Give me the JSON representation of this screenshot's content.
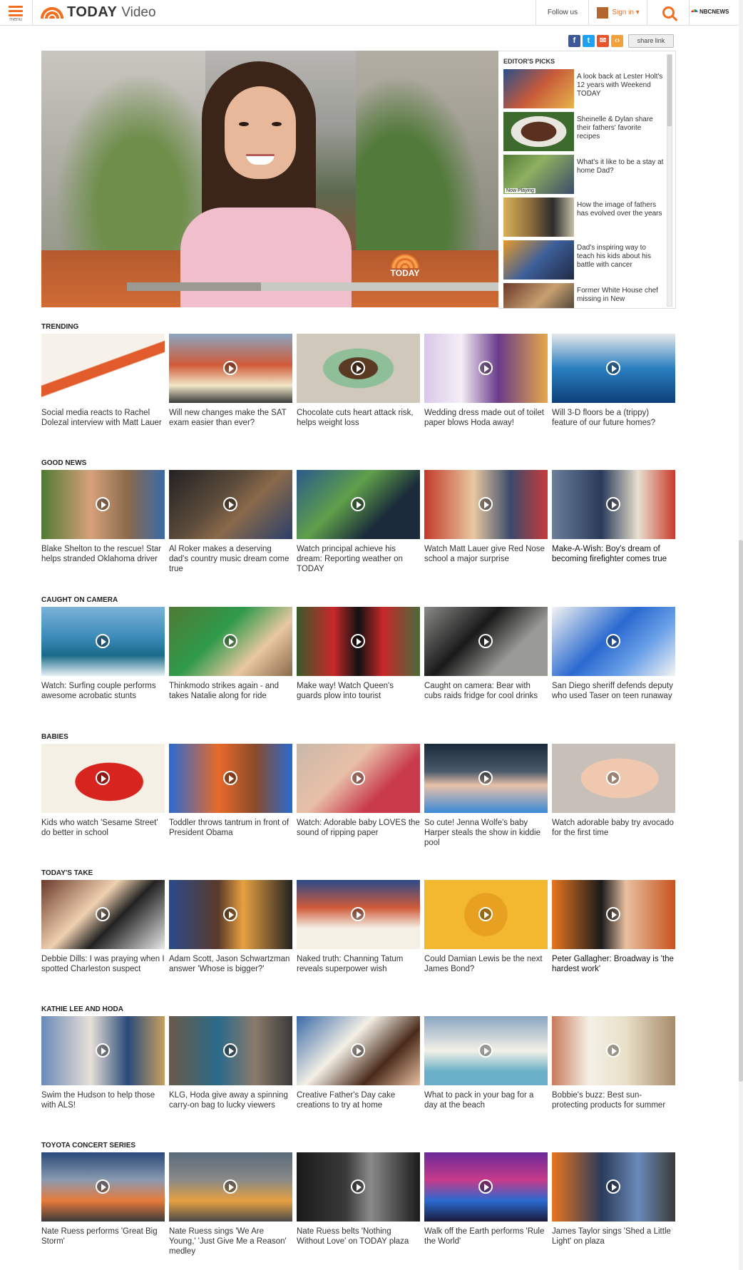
{
  "header": {
    "menu_label": "menu",
    "brand": "TODAY",
    "brand_sub": "Video",
    "follow": "Follow us",
    "signin": "Sign in ▾",
    "network": "NBCNEWS"
  },
  "share": {
    "icons": [
      "facebook-icon",
      "twitter-icon",
      "email-icon",
      "embed-icon"
    ],
    "link_label": "share link"
  },
  "player": {
    "bug_text": "TODAY",
    "progress": 0.36
  },
  "editors_picks": {
    "title": "EDITOR'S PICKS",
    "now_playing": "Now Playing",
    "items": [
      {
        "title": "A look back at Lester Holt's 12 years with Weekend TODAY"
      },
      {
        "title": "Sheinelle & Dylan share their fathers' favorite recipes"
      },
      {
        "title": "What's it like to be a stay at home Dad?"
      },
      {
        "title": "How the image of fathers has evolved over the years"
      },
      {
        "title": "Dad's inspiring way to teach his kids about his battle with cancer"
      },
      {
        "title": "Former White House chef missing in New"
      }
    ]
  },
  "sections": [
    {
      "title": "TRENDING",
      "items": [
        {
          "caption": "Social media reacts to Rachel Dolezal interview with Matt Lauer"
        },
        {
          "caption": "Will new changes make the SAT exam easier than ever?"
        },
        {
          "caption": "Chocolate cuts heart attack risk, helps weight loss"
        },
        {
          "caption": "Wedding dress made out of toilet paper blows Hoda away!"
        },
        {
          "caption": "Will 3-D floors be a (trippy) feature of our future homes?"
        }
      ]
    },
    {
      "title": "GOOD NEWS",
      "items": [
        {
          "caption": "Blake Shelton to the rescue! Star helps stranded Oklahoma driver"
        },
        {
          "caption": "Al Roker makes a deserving dad's country music dream come true"
        },
        {
          "caption": "Watch principal achieve his dream: Reporting weather on TODAY"
        },
        {
          "caption": "Watch Matt Lauer give Red Nose school a major surprise"
        },
        {
          "caption": "Make-A-Wish: Boy's dream of becoming firefighter comes true"
        }
      ]
    },
    {
      "title": "CAUGHT ON CAMERA",
      "items": [
        {
          "caption": "Watch: Surfing couple performs awesome acrobatic stunts"
        },
        {
          "caption": "Thinkmodo strikes again - and takes Natalie along for ride"
        },
        {
          "caption": "Make way! Watch Queen's guards plow into tourist"
        },
        {
          "caption": "Caught on camera: Bear with cubs raids fridge for cool drinks"
        },
        {
          "caption": "San Diego sheriff defends deputy who used Taser on teen runaway"
        }
      ]
    },
    {
      "title": "BABIES",
      "items": [
        {
          "caption": "Kids who watch 'Sesame Street' do better in school"
        },
        {
          "caption": "Toddler throws tantrum in front of President Obama"
        },
        {
          "caption": "Watch: Adorable baby LOVES the sound of ripping paper"
        },
        {
          "caption": "So cute! Jenna Wolfe's baby Harper steals the show in kiddie pool"
        },
        {
          "caption": "Watch adorable baby try avocado for the first time"
        }
      ]
    },
    {
      "title": "TODAY'S TAKE",
      "items": [
        {
          "caption": "Debbie Dills: I was praying when I spotted Charleston suspect"
        },
        {
          "caption": "Adam Scott, Jason Schwartzman answer 'Whose is bigger?'"
        },
        {
          "caption": "Naked truth: Channing Tatum reveals superpower wish"
        },
        {
          "caption": "Could Damian Lewis be the next James Bond?"
        },
        {
          "caption": "Peter Gallagher: Broadway is 'the hardest work'"
        }
      ]
    },
    {
      "title": "KATHIE LEE AND HODA",
      "items": [
        {
          "caption": "Swim the Hudson to help those with ALS!"
        },
        {
          "caption": "KLG, Hoda give away a spinning carry-on bag to lucky viewers"
        },
        {
          "caption": "Creative Father's Day cake creations to try at home"
        },
        {
          "caption": "What to pack in your bag for a day at the beach"
        },
        {
          "caption": "Bobbie's buzz: Best sun-protecting products for summer"
        }
      ]
    },
    {
      "title": "TOYOTA CONCERT SERIES",
      "items": [
        {
          "caption": "Nate Ruess performs 'Great Big Storm'"
        },
        {
          "caption": "Nate Ruess sings 'We Are Young,' 'Just Give Me a Reason' medley"
        },
        {
          "caption": "Nate Ruess belts 'Nothing Without Love' on TODAY plaza"
        },
        {
          "caption": "Walk off the Earth performs 'Rule the World'"
        },
        {
          "caption": "James Taylor sings 'Shed a Little Light' on plaza"
        }
      ]
    }
  ]
}
